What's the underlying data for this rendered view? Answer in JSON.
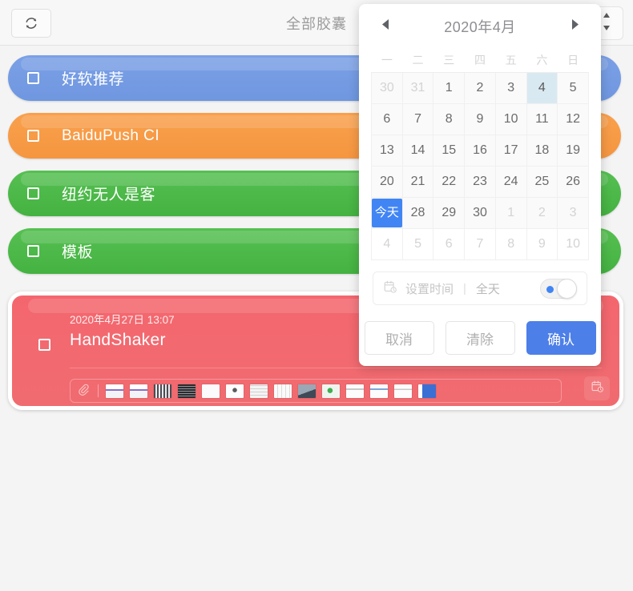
{
  "topbar": {
    "refresh_icon": "refresh-icon",
    "title": "全部胶囊",
    "sort_icon": "sort-updown-icon"
  },
  "capsules": [
    {
      "label": "好软推荐",
      "color": "#6f97e0",
      "color2": "#7ba0e6"
    },
    {
      "label": "BaiduPush CI",
      "color": "#f59640",
      "color2": "#f9a04c"
    },
    {
      "label": "纽约无人是客",
      "color": "#4cb849",
      "color2": "#56c052"
    },
    {
      "label": "模板",
      "color": "#4cb849",
      "color2": "#56c052"
    }
  ],
  "selected_card": {
    "time": "2020年4月27日 13:07",
    "title": "HandShaker",
    "clip_icon": "paperclip-icon",
    "calendar_clock_icon": "calendar-clock-icon",
    "attachment_count": 14,
    "attachments": [
      {
        "name": "thumbnail-1",
        "tone": "#ece9f6",
        "accent": "#8a6fc8"
      },
      {
        "name": "thumbnail-2",
        "tone": "#ece9f6",
        "accent": "#8a6fc8"
      },
      {
        "name": "thumbnail-3",
        "tone": "#e8e8ec",
        "accent": "#46474d"
      },
      {
        "name": "thumbnail-4",
        "tone": "#2b2b2e",
        "accent": "#9aa0a6"
      },
      {
        "name": "thumbnail-5",
        "tone": "#fbfbfb",
        "accent": "#d8d8d8"
      },
      {
        "name": "thumbnail-6",
        "tone": "#fdfdfd",
        "accent": "#6b6b6b"
      },
      {
        "name": "thumbnail-7",
        "tone": "#f4f4f4",
        "accent": "#bcbcbc"
      },
      {
        "name": "thumbnail-8",
        "tone": "#fafafa",
        "accent": "#cacaca"
      },
      {
        "name": "thumbnail-9",
        "tone": "#9aa7b4",
        "accent": "#3f4a56"
      },
      {
        "name": "thumbnail-10",
        "tone": "#e6efe6",
        "accent": "#3fae50"
      },
      {
        "name": "thumbnail-11",
        "tone": "#fcfcfc",
        "accent": "#c9c9c9"
      },
      {
        "name": "thumbnail-12",
        "tone": "#fcfcfc",
        "accent": "#7fa6d8"
      },
      {
        "name": "thumbnail-13",
        "tone": "#fcfcfc",
        "accent": "#c9c9c9"
      },
      {
        "name": "thumbnail-14",
        "tone": "#ffffff",
        "accent": "#3b6fd4"
      }
    ]
  },
  "datepicker": {
    "prev_icon": "triangle-left-icon",
    "next_icon": "triangle-right-icon",
    "month_title": "2020年4月",
    "weekdays": [
      "一",
      "二",
      "三",
      "四",
      "五",
      "六",
      "日"
    ],
    "weeks": [
      [
        {
          "text": "30",
          "state": "muted"
        },
        {
          "text": "31",
          "state": "muted"
        },
        {
          "text": "1",
          "state": "normal"
        },
        {
          "text": "2",
          "state": "normal"
        },
        {
          "text": "3",
          "state": "normal"
        },
        {
          "text": "4",
          "state": "highlight"
        },
        {
          "text": "5",
          "state": "normal"
        }
      ],
      [
        {
          "text": "6",
          "state": "normal"
        },
        {
          "text": "7",
          "state": "normal"
        },
        {
          "text": "8",
          "state": "normal"
        },
        {
          "text": "9",
          "state": "normal"
        },
        {
          "text": "10",
          "state": "normal"
        },
        {
          "text": "11",
          "state": "normal"
        },
        {
          "text": "12",
          "state": "normal"
        }
      ],
      [
        {
          "text": "13",
          "state": "normal"
        },
        {
          "text": "14",
          "state": "normal"
        },
        {
          "text": "15",
          "state": "normal"
        },
        {
          "text": "16",
          "state": "normal"
        },
        {
          "text": "17",
          "state": "normal"
        },
        {
          "text": "18",
          "state": "normal"
        },
        {
          "text": "19",
          "state": "normal"
        }
      ],
      [
        {
          "text": "20",
          "state": "normal"
        },
        {
          "text": "21",
          "state": "normal"
        },
        {
          "text": "22",
          "state": "normal"
        },
        {
          "text": "23",
          "state": "normal"
        },
        {
          "text": "24",
          "state": "normal"
        },
        {
          "text": "25",
          "state": "normal"
        },
        {
          "text": "26",
          "state": "normal"
        }
      ],
      [
        {
          "text": "今天",
          "state": "today"
        },
        {
          "text": "28",
          "state": "normal"
        },
        {
          "text": "29",
          "state": "normal"
        },
        {
          "text": "30",
          "state": "normal"
        },
        {
          "text": "1",
          "state": "muted"
        },
        {
          "text": "2",
          "state": "muted"
        },
        {
          "text": "3",
          "state": "muted"
        }
      ],
      [
        {
          "text": "4",
          "state": "muted-plain"
        },
        {
          "text": "5",
          "state": "muted-plain"
        },
        {
          "text": "6",
          "state": "muted-plain"
        },
        {
          "text": "7",
          "state": "muted-plain"
        },
        {
          "text": "8",
          "state": "muted-plain"
        },
        {
          "text": "9",
          "state": "muted-plain"
        },
        {
          "text": "10",
          "state": "muted-plain"
        }
      ]
    ],
    "time_icon": "calendar-clock-icon",
    "time_label": "设置时间",
    "separator": "|",
    "allday_label": "全天",
    "allday_on": false,
    "buttons": {
      "cancel": "取消",
      "clear": "清除",
      "confirm": "确认"
    }
  },
  "colors": {
    "accent_blue": "#4185f4",
    "confirm_blue": "#4d7fe8",
    "selected_red": "#f2696f",
    "highlight_cell": "#d9e9f2"
  }
}
